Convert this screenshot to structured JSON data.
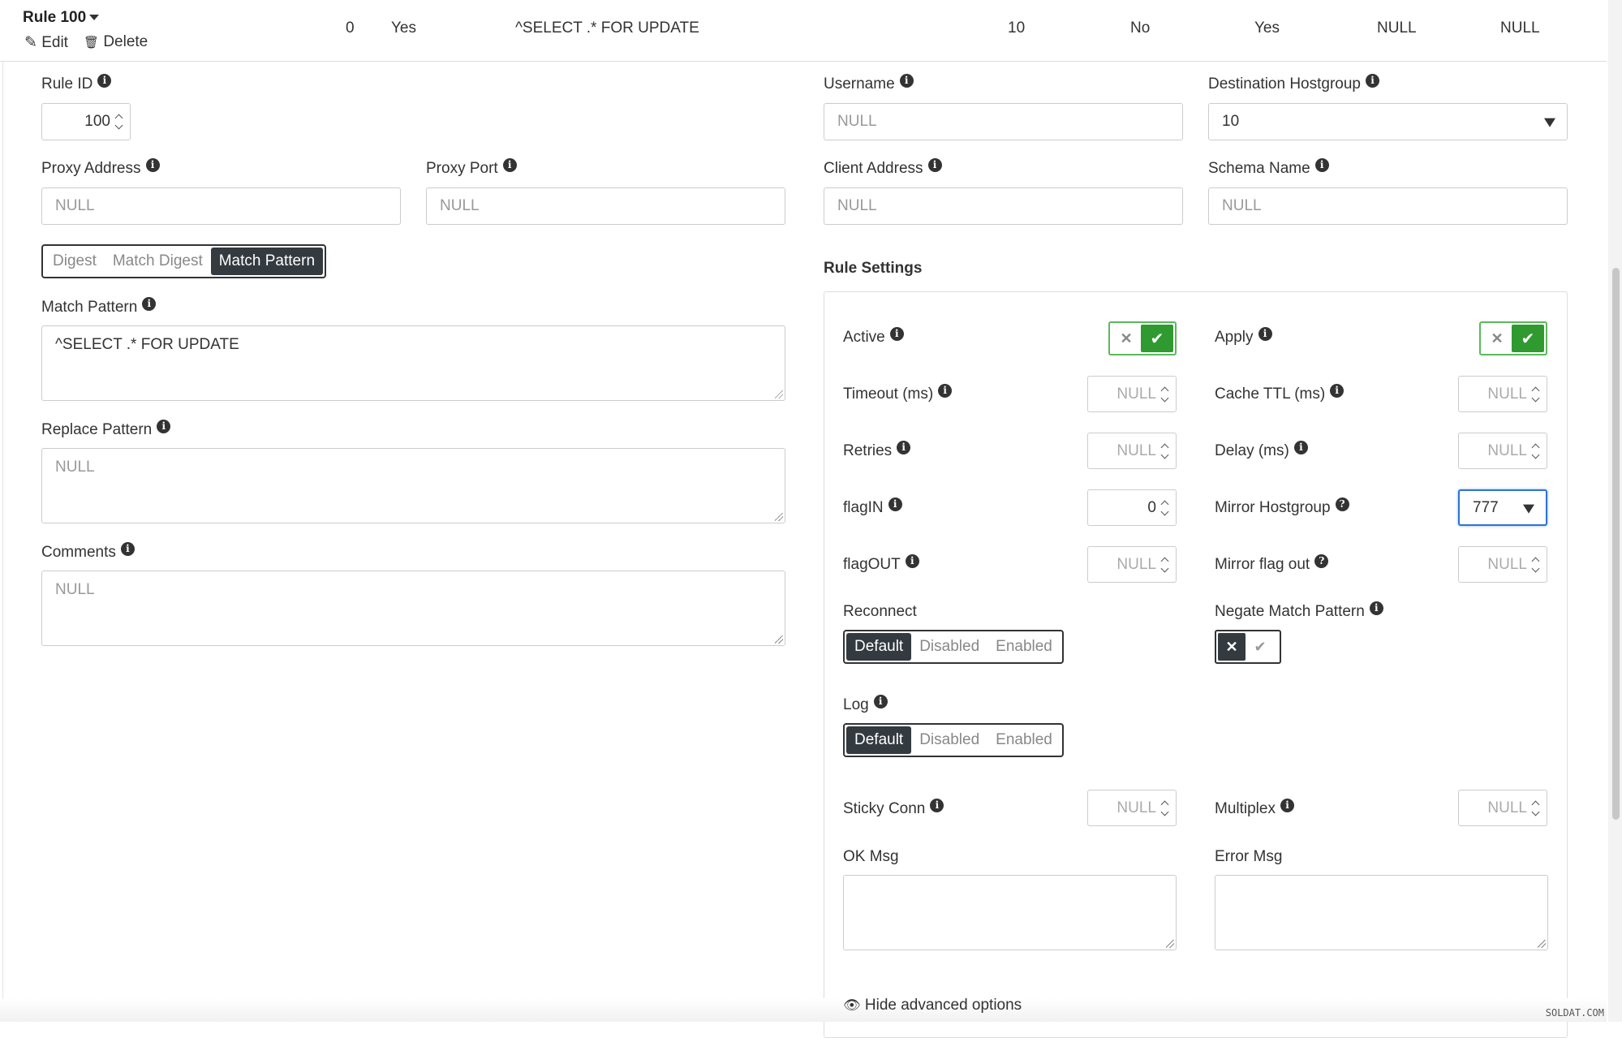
{
  "header": {
    "rule_title": "Rule 100",
    "edit_label": "Edit",
    "delete_label": "Delete",
    "cells": [
      "0",
      "Yes",
      "^SELECT .* FOR UPDATE",
      "10",
      "No",
      "Yes",
      "NULL",
      "NULL"
    ]
  },
  "form": {
    "rule_id": {
      "label": "Rule ID",
      "value": "100"
    },
    "username": {
      "label": "Username",
      "placeholder": "NULL"
    },
    "destination_hostgroup": {
      "label": "Destination Hostgroup",
      "value": "10"
    },
    "proxy_address": {
      "label": "Proxy Address",
      "placeholder": "NULL"
    },
    "proxy_port": {
      "label": "Proxy Port",
      "placeholder": "NULL"
    },
    "client_address": {
      "label": "Client Address",
      "placeholder": "NULL"
    },
    "schema_name": {
      "label": "Schema Name",
      "placeholder": "NULL"
    },
    "match_tabs": {
      "options": [
        "Digest",
        "Match Digest",
        "Match Pattern"
      ],
      "selected": "Match Pattern"
    },
    "match_pattern": {
      "label": "Match Pattern",
      "value": "^SELECT .* FOR UPDATE"
    },
    "replace_pattern": {
      "label": "Replace Pattern",
      "placeholder": "NULL"
    },
    "comments": {
      "label": "Comments",
      "placeholder": "NULL"
    }
  },
  "rule_settings": {
    "title": "Rule Settings",
    "active": {
      "label": "Active",
      "value": true
    },
    "apply": {
      "label": "Apply",
      "value": true
    },
    "timeout": {
      "label": "Timeout (ms)",
      "placeholder": "NULL"
    },
    "cache_ttl": {
      "label": "Cache TTL (ms)",
      "placeholder": "NULL"
    },
    "retries": {
      "label": "Retries",
      "placeholder": "NULL"
    },
    "delay": {
      "label": "Delay (ms)",
      "placeholder": "NULL"
    },
    "flag_in": {
      "label": "flagIN",
      "value": "0"
    },
    "mirror_hostgroup": {
      "label": "Mirror Hostgroup",
      "value": "777"
    },
    "flag_out": {
      "label": "flagOUT",
      "placeholder": "NULL"
    },
    "mirror_flag_out": {
      "label": "Mirror flag out",
      "placeholder": "NULL"
    },
    "reconnect": {
      "label": "Reconnect",
      "options": [
        "Default",
        "Disabled",
        "Enabled"
      ],
      "selected": "Default"
    },
    "negate_match_pattern": {
      "label": "Negate Match Pattern",
      "value": false
    },
    "log": {
      "label": "Log",
      "options": [
        "Default",
        "Disabled",
        "Enabled"
      ],
      "selected": "Default"
    },
    "sticky_conn": {
      "label": "Sticky Conn",
      "placeholder": "NULL"
    },
    "multiplex": {
      "label": "Multiplex",
      "placeholder": "NULL"
    },
    "ok_msg": {
      "label": "OK Msg",
      "value": ""
    },
    "error_msg": {
      "label": "Error Msg",
      "value": ""
    },
    "hide_advanced": "Hide advanced options"
  },
  "watermark": "SOLDAT.COM",
  "colors": {
    "toggle_on": "#2f9a2f",
    "dark": "#333a40",
    "mirror_focus": "#2d73d4"
  }
}
